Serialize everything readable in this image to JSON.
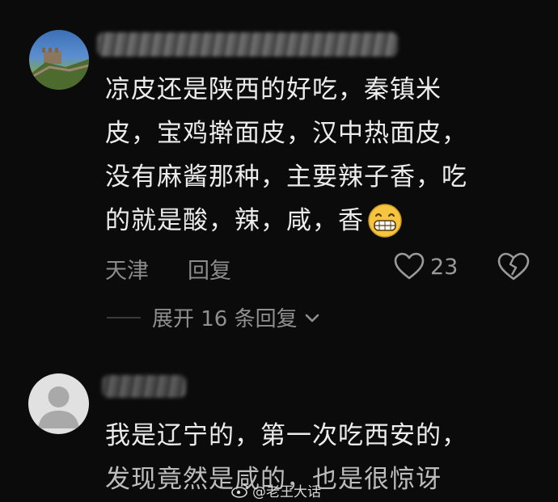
{
  "comment1": {
    "location": "天津",
    "reply_label": "回复",
    "like_count": "23",
    "text_lines": [
      "凉皮还是陕西的好吃，秦镇米",
      "皮，宝鸡擀面皮，汉中热面皮，",
      "没有麻酱那种，主要辣子香，吃",
      "的就是酸，辣，咸，香"
    ]
  },
  "expand_replies": {
    "label": "展开 16 条回复"
  },
  "comment2": {
    "text_lines": [
      "我是辽宁的，第一次吃西安的，",
      "发现竟然是咸的，也是很惊讶"
    ]
  },
  "watermark": {
    "text": "@老王大话"
  },
  "icons": {
    "emoji": "grinning-face-icon",
    "like": "heart-outline-icon",
    "dislike": "broken-heart-icon",
    "expand": "chevron-down-icon"
  },
  "colors": {
    "background": "#0b0b0b",
    "text": "#ececec",
    "meta": "#8c8c8c"
  }
}
